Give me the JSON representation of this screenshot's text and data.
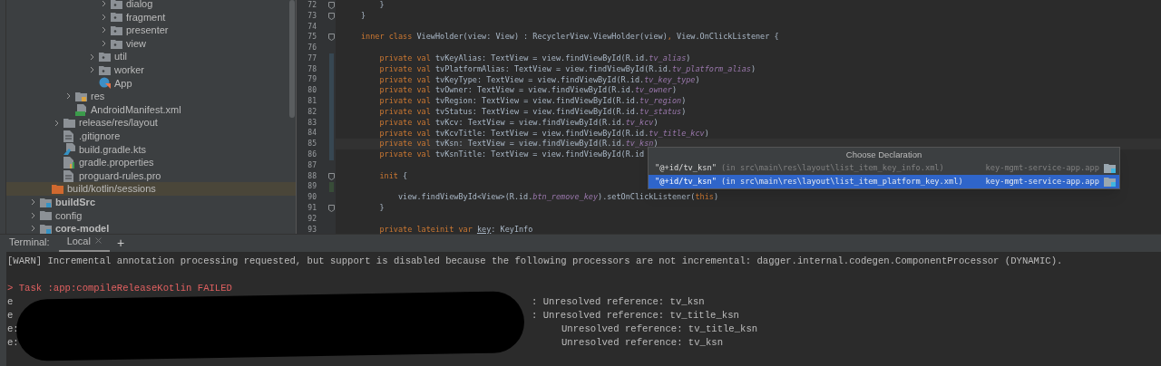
{
  "project_tree": {
    "items": [
      {
        "children": [
          {
            "children": [
              {
                "children": [
                  {
                    "children": [
                      {
                        "children": [
                          {
                            "children": [
                              {
                                "label": "dialog",
                                "kind": "package",
                                "expanded": false,
                                "selected": false
                              },
                              {
                                "label": "fragment",
                                "kind": "package",
                                "expanded": false,
                                "selected": false
                              },
                              {
                                "label": "presenter",
                                "kind": "package",
                                "expanded": false,
                                "selected": false
                              },
                              {
                                "label": "view",
                                "kind": "package",
                                "expanded": false,
                                "selected": false
                              }
                            ]
                          },
                          {
                            "label": "util",
                            "kind": "package",
                            "expanded": false,
                            "selected": false
                          },
                          {
                            "label": "worker",
                            "kind": "package",
                            "expanded": false,
                            "selected": false
                          },
                          {
                            "label": "App",
                            "kind": "class",
                            "selected": false
                          }
                        ]
                      }
                    ]
                  },
                  {
                    "label": "res",
                    "kind": "res-folder",
                    "expanded": false,
                    "selected": false
                  },
                  {
                    "label": "AndroidManifest.xml",
                    "kind": "manifest",
                    "selected": false
                  }
                ]
              },
              {
                "label": "release/res/layout",
                "kind": "folder",
                "expanded": false,
                "selected": false
              },
              {
                "label": ".gitignore",
                "kind": "file",
                "selected": false
              },
              {
                "label": "build.gradle.kts",
                "kind": "gradle",
                "selected": false
              },
              {
                "label": "gradle.properties",
                "kind": "properties",
                "selected": false
              },
              {
                "label": "proguard-rules.pro",
                "kind": "file",
                "selected": false
              }
            ]
          },
          {
            "label": "build/kotlin/sessions",
            "kind": "excluded-folder",
            "selected": true
          }
        ]
      },
      {
        "label": "buildSrc",
        "kind": "module",
        "expanded": false,
        "selected": false
      },
      {
        "label": "config",
        "kind": "folder",
        "expanded": false,
        "selected": false
      },
      {
        "label": "core-model",
        "kind": "module",
        "expanded": false,
        "selected": false
      }
    ]
  },
  "editor": {
    "lines": [
      {
        "number": "72",
        "fold": true,
        "tokens": [
          {
            "kind": "plain",
            "text": "    }"
          }
        ]
      },
      {
        "number": "73",
        "fold": true,
        "tokens": [
          {
            "kind": "plain",
            "text": "}"
          }
        ]
      },
      {
        "number": "74"
      },
      {
        "number": "75",
        "fold": true,
        "tokens": [
          {
            "kind": "keyword",
            "text": "inner class "
          },
          {
            "kind": "plain",
            "text": "ViewHolder(view: View) : RecyclerView.ViewHolder(view)"
          },
          {
            "kind": "keyword",
            "text": ","
          },
          {
            "kind": "plain",
            "text": " View.OnClickListener {"
          }
        ]
      },
      {
        "number": "76"
      },
      {
        "number": "77",
        "modified": true,
        "tokens": [
          {
            "kind": "keyword",
            "text": "    private val "
          },
          {
            "kind": "field",
            "text": "tvKeyAlias"
          },
          {
            "kind": "plain",
            "text": ": TextView = view.findViewById(R.id."
          },
          {
            "kind": "id",
            "text": "tv_alias"
          },
          {
            "kind": "plain",
            "text": ")"
          }
        ]
      },
      {
        "number": "78",
        "modified": true,
        "tokens": [
          {
            "kind": "keyword",
            "text": "    private val "
          },
          {
            "kind": "field",
            "text": "tvPlatformAlias"
          },
          {
            "kind": "plain",
            "text": ": TextView = view.findViewById(R.id."
          },
          {
            "kind": "id",
            "text": "tv_platform_alias"
          },
          {
            "kind": "plain",
            "text": ")"
          }
        ]
      },
      {
        "number": "79",
        "modified": true,
        "tokens": [
          {
            "kind": "keyword",
            "text": "    private val "
          },
          {
            "kind": "field",
            "text": "tvKeyType"
          },
          {
            "kind": "plain",
            "text": ": TextView = view.findViewById(R.id."
          },
          {
            "kind": "id",
            "text": "tv_key_type"
          },
          {
            "kind": "plain",
            "text": ")"
          }
        ]
      },
      {
        "number": "80",
        "modified": true,
        "tokens": [
          {
            "kind": "keyword",
            "text": "    private val "
          },
          {
            "kind": "field",
            "text": "tvOwner"
          },
          {
            "kind": "plain",
            "text": ": TextView = view.findViewById(R.id."
          },
          {
            "kind": "id",
            "text": "tv_owner"
          },
          {
            "kind": "plain",
            "text": ")"
          }
        ]
      },
      {
        "number": "81",
        "modified": true,
        "tokens": [
          {
            "kind": "keyword",
            "text": "    private val "
          },
          {
            "kind": "field",
            "text": "tvRegion"
          },
          {
            "kind": "plain",
            "text": ": TextView = view.findViewById(R.id."
          },
          {
            "kind": "id",
            "text": "tv_region"
          },
          {
            "kind": "plain",
            "text": ")"
          }
        ]
      },
      {
        "number": "82",
        "modified": true,
        "tokens": [
          {
            "kind": "keyword",
            "text": "    private val "
          },
          {
            "kind": "field",
            "text": "tvStatus"
          },
          {
            "kind": "plain",
            "text": ": TextView = view.findViewById(R.id."
          },
          {
            "kind": "id",
            "text": "tv_status"
          },
          {
            "kind": "plain",
            "text": ")"
          }
        ]
      },
      {
        "number": "83",
        "modified": true,
        "tokens": [
          {
            "kind": "keyword",
            "text": "    private val "
          },
          {
            "kind": "field",
            "text": "tvKcv"
          },
          {
            "kind": "plain",
            "text": ": TextView = view.findViewById(R.id."
          },
          {
            "kind": "id",
            "text": "tv_kcv"
          },
          {
            "kind": "plain",
            "text": ")"
          }
        ]
      },
      {
        "number": "84",
        "modified": true,
        "tokens": [
          {
            "kind": "keyword",
            "text": "    private val "
          },
          {
            "kind": "field",
            "text": "tvKcvTitle"
          },
          {
            "kind": "plain",
            "text": ": TextView = view.findViewById(R.id."
          },
          {
            "kind": "id",
            "text": "tv_title_kcv"
          },
          {
            "kind": "plain",
            "text": ")"
          }
        ]
      },
      {
        "number": "85",
        "modified": true,
        "current": true,
        "tokens": [
          {
            "kind": "keyword",
            "text": "    private val "
          },
          {
            "kind": "field",
            "text": "tvKsn"
          },
          {
            "kind": "plain",
            "text": ": TextView = view.findViewById(R.id."
          },
          {
            "kind": "id",
            "text": "tv_ksn"
          },
          {
            "kind": "plain",
            "text": ")"
          }
        ]
      },
      {
        "number": "86",
        "modified": true,
        "tokens": [
          {
            "kind": "keyword",
            "text": "    private val "
          },
          {
            "kind": "field",
            "text": "tvKsnTitle"
          },
          {
            "kind": "plain",
            "text": ": TextView = view.findViewById(R.id"
          }
        ]
      },
      {
        "number": "87"
      },
      {
        "number": "88",
        "fold": true,
        "tokens": [
          {
            "kind": "keyword",
            "text": "    init "
          },
          {
            "kind": "plain",
            "text": "{"
          }
        ]
      },
      {
        "number": "89",
        "added": true
      },
      {
        "number": "90",
        "tokens": [
          {
            "kind": "plain",
            "text": "        view.findViewById<View>(R.id."
          },
          {
            "kind": "id",
            "text": "btn_remove_key"
          },
          {
            "kind": "plain",
            "text": ").setOnClickListener("
          },
          {
            "kind": "keyword",
            "text": "this"
          },
          {
            "kind": "plain",
            "text": ")"
          }
        ]
      },
      {
        "number": "91",
        "fold": true,
        "tokens": [
          {
            "kind": "plain",
            "text": "    }"
          }
        ]
      },
      {
        "number": "92"
      },
      {
        "number": "93",
        "tokens": [
          {
            "kind": "keyword",
            "text": "    private lateinit var "
          },
          {
            "kind": "underlined",
            "text": "key"
          },
          {
            "kind": "plain",
            "text": ": KeyInfo"
          }
        ]
      }
    ]
  },
  "declaration_popup": {
    "title": "Choose Declaration",
    "rows": [
      {
        "id": "\"@+id/tv_ksn\"",
        "location": "(in src\\main\\res\\layout\\list_item_key_info.xml)",
        "module": "key-mgmt-service-app.app",
        "selected": false
      },
      {
        "id": "\"@+id/tv_ksn\"",
        "location": "(in src\\main\\res\\layout\\list_item_platform_key.xml)",
        "module": "key-mgmt-service-app.app",
        "selected": true
      }
    ]
  },
  "terminal": {
    "label": "Terminal:",
    "tabs": [
      {
        "label": "Local",
        "selected": true
      }
    ],
    "add_label": "+",
    "lines": [
      {
        "kind": "warn",
        "text": "[WARN] Incremental annotation processing requested, but support is disabled because the following processors are not incremental: dagger.internal.codegen.ComponentProcessor (DYNAMIC)."
      },
      {
        "kind": "blank"
      },
      {
        "kind": "task",
        "text": "> Task :app:compileReleaseKotlin FAILED"
      },
      {
        "kind": "error",
        "prefix": "e",
        "text": ": Unresolved reference: tv_ksn"
      },
      {
        "kind": "error",
        "prefix": "e",
        "text": ": Unresolved reference: tv_title_ksn"
      },
      {
        "kind": "error",
        "prefix": "e:",
        "text": "Unresolved reference: tv_title_ksn"
      },
      {
        "kind": "error",
        "prefix": "e:",
        "text": "Unresolved reference: tv_ksn"
      }
    ]
  }
}
